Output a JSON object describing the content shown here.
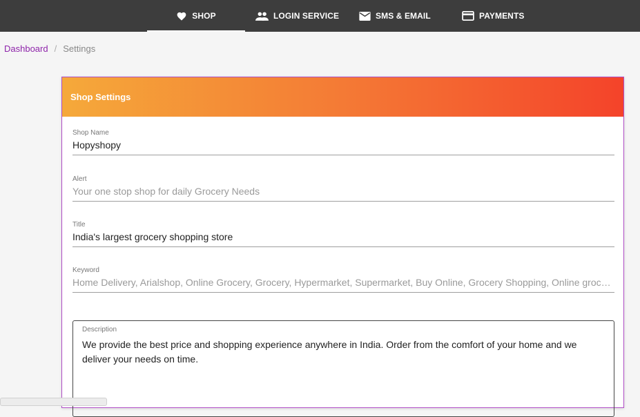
{
  "nav": {
    "tabs": [
      {
        "label": "SHOP",
        "icon": "heart-icon",
        "active": true
      },
      {
        "label": "LOGIN SERVICE",
        "icon": "people-icon",
        "active": false
      },
      {
        "label": "SMS & EMAIL",
        "icon": "mail-icon",
        "active": false
      },
      {
        "label": "PAYMENTS",
        "icon": "credit-card-icon",
        "active": false
      }
    ]
  },
  "breadcrumb": {
    "home": "Dashboard",
    "separator": "/",
    "current": "Settings"
  },
  "card": {
    "title": "Shop Settings",
    "fields": {
      "shop_name": {
        "label": "Shop Name",
        "value": "Hopyshopy"
      },
      "alert": {
        "label": "Alert",
        "placeholder": "Your one stop shop for daily Grocery Needs"
      },
      "title": {
        "label": "Title",
        "value": "India's largest grocery shopping store"
      },
      "keyword": {
        "label": "Keyword",
        "placeholder": "Home Delivery, Arialshop, Online Grocery, Grocery, Hypermarket, Supermarket, Buy Online, Grocery Shopping, Online grocery shopping"
      },
      "description": {
        "label": "Description",
        "value": "We provide the best price and shopping experience anywhere in India. Order from the comfort of your home and we deliver your needs on time."
      }
    }
  },
  "colors": {
    "accent": "#8e24aa",
    "header_start": "#f5a93a",
    "header_end": "#f4432a",
    "topbar": "#3d3d3d"
  }
}
